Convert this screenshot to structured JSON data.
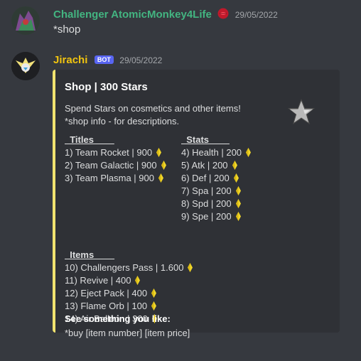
{
  "message1": {
    "username": "Challenger AtomicMonkey4Life",
    "username_color": "#43b581",
    "badge_icon": "red-lips-emoji-icon",
    "timestamp": "29/05/2022",
    "content": "*shop"
  },
  "message2": {
    "username": "Jirachi",
    "username_color": "#f1c40f",
    "bot_tag": "BOT",
    "timestamp": "29/05/2022",
    "embed": {
      "accent_color": "#f1e36f",
      "title": "Shop | 300 Stars",
      "description_lines": [
        "Spend Stars on cosmetics and other items!",
        "*shop info - for descriptions."
      ],
      "thumbnail_icon": "silver-star-icon",
      "titles": {
        "heading": "  Titles        ",
        "items": [
          "1) Team Rocket | 900",
          "2) Team Galactic | 900",
          "3) Team Plasma | 900"
        ]
      },
      "stats": {
        "heading": "  Stats        ",
        "items": [
          "4) Health | 200",
          "5) Atk | 200",
          "6) Def | 200",
          "7) Spa | 200",
          "8) Spd | 200",
          "9) Spe | 200"
        ]
      },
      "shop_items": {
        "heading": "  Items        ",
        "items": [
          "10) Challengers Pass | 1.600",
          "11) Revive | 400",
          "12) Eject Pack | 400",
          "13) Flame Orb | 100",
          "14) Air Balloon | 300"
        ]
      },
      "footer_title": "See something you like:",
      "footer_text": "*buy [item number] [item price]"
    }
  }
}
